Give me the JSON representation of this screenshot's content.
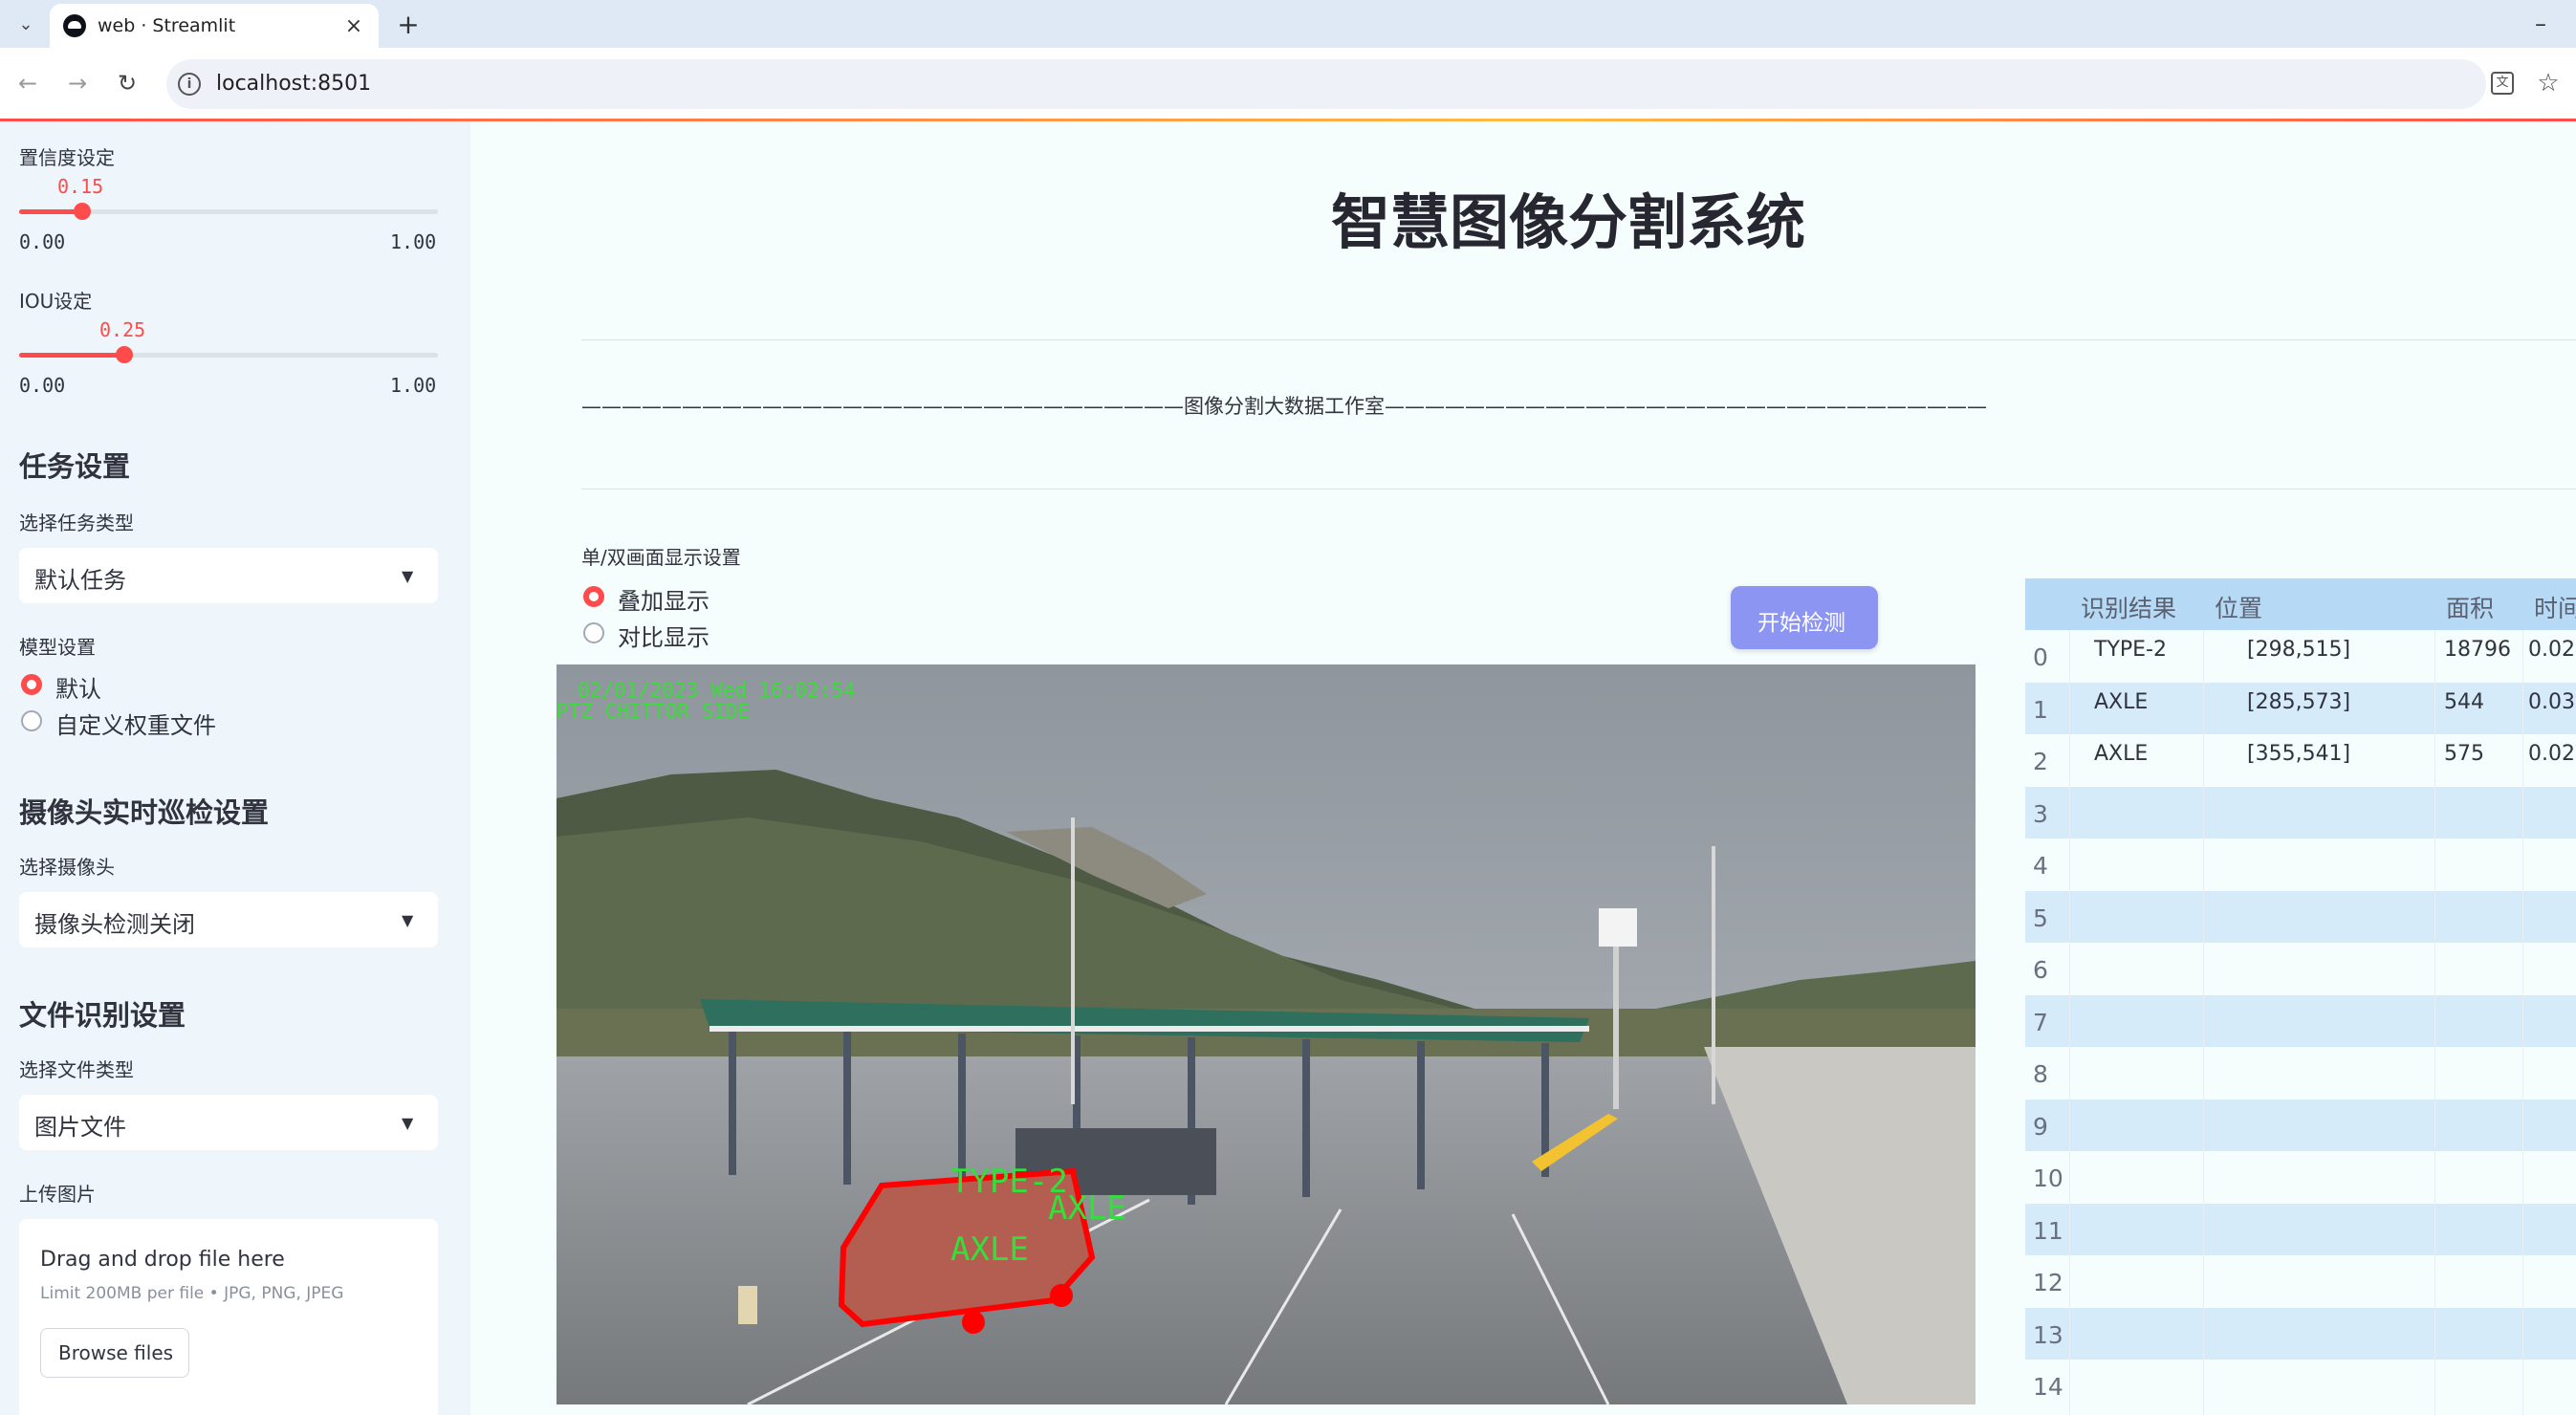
{
  "browser": {
    "tab_title": "web · Streamlit",
    "url": "localhost:8501"
  },
  "sidebar": {
    "confidence": {
      "label": "置信度设定",
      "value": "0.15",
      "min": "0.00",
      "max": "1.00",
      "fraction": 0.15
    },
    "iou": {
      "label": "IOU设定",
      "value": "0.25",
      "min": "0.00",
      "max": "1.00",
      "fraction": 0.25
    },
    "task": {
      "heading": "任务设置",
      "select_label": "选择任务类型",
      "selected": "默认任务"
    },
    "model": {
      "label": "模型设置",
      "options": [
        "默认",
        "自定义权重文件"
      ],
      "selected_index": 0
    },
    "camera": {
      "heading": "摄像头实时巡检设置",
      "select_label": "选择摄像头",
      "selected": "摄像头检测关闭"
    },
    "file": {
      "heading": "文件识别设置",
      "select_label": "选择文件类型",
      "selected": "图片文件"
    },
    "upload": {
      "label": "上传图片",
      "drop_text": "Drag and drop file here",
      "limit_text": "Limit 200MB per file • JPG, PNG, JPEG",
      "browse_label": "Browse files"
    }
  },
  "main": {
    "title": "智慧图像分割系统",
    "divider_text": "——————————————————————————————图像分割大数据工作室——————————————————————————————",
    "display": {
      "label": "单/双画面显示设置",
      "options": [
        "叠加显示",
        "对比显示"
      ],
      "selected_index": 0
    },
    "start_button": "开始检测",
    "image": {
      "timestamp": "02/01/2023 Wed 16:02:54",
      "camera_label": "PTZ  CHITTOR SIDE",
      "detections": [
        "TYPE-2",
        "AXLE",
        "AXLE"
      ]
    },
    "table": {
      "headers": [
        "",
        "识别结果",
        "位置",
        "面积",
        "时间"
      ],
      "rows": [
        [
          "0",
          "TYPE-2",
          "[298,515]",
          "18796",
          "0.02"
        ],
        [
          "1",
          "AXLE",
          "[285,573]",
          "544",
          "0.03"
        ],
        [
          "2",
          "AXLE",
          "[355,541]",
          "575",
          "0.02"
        ],
        [
          "3",
          "",
          "",
          "",
          ""
        ],
        [
          "4",
          "",
          "",
          "",
          ""
        ],
        [
          "5",
          "",
          "",
          "",
          ""
        ],
        [
          "6",
          "",
          "",
          "",
          ""
        ],
        [
          "7",
          "",
          "",
          "",
          ""
        ],
        [
          "8",
          "",
          "",
          "",
          ""
        ],
        [
          "9",
          "",
          "",
          "",
          ""
        ],
        [
          "10",
          "",
          "",
          "",
          ""
        ],
        [
          "11",
          "",
          "",
          "",
          ""
        ],
        [
          "12",
          "",
          "",
          "",
          ""
        ],
        [
          "13",
          "",
          "",
          "",
          ""
        ],
        [
          "14",
          "",
          "",
          "",
          ""
        ]
      ]
    }
  },
  "colors": {
    "accent": "#ff4b4b",
    "button": "#8d95f3",
    "table_header": "#b6d9f5",
    "table_stripe": "#d6ebfa"
  }
}
